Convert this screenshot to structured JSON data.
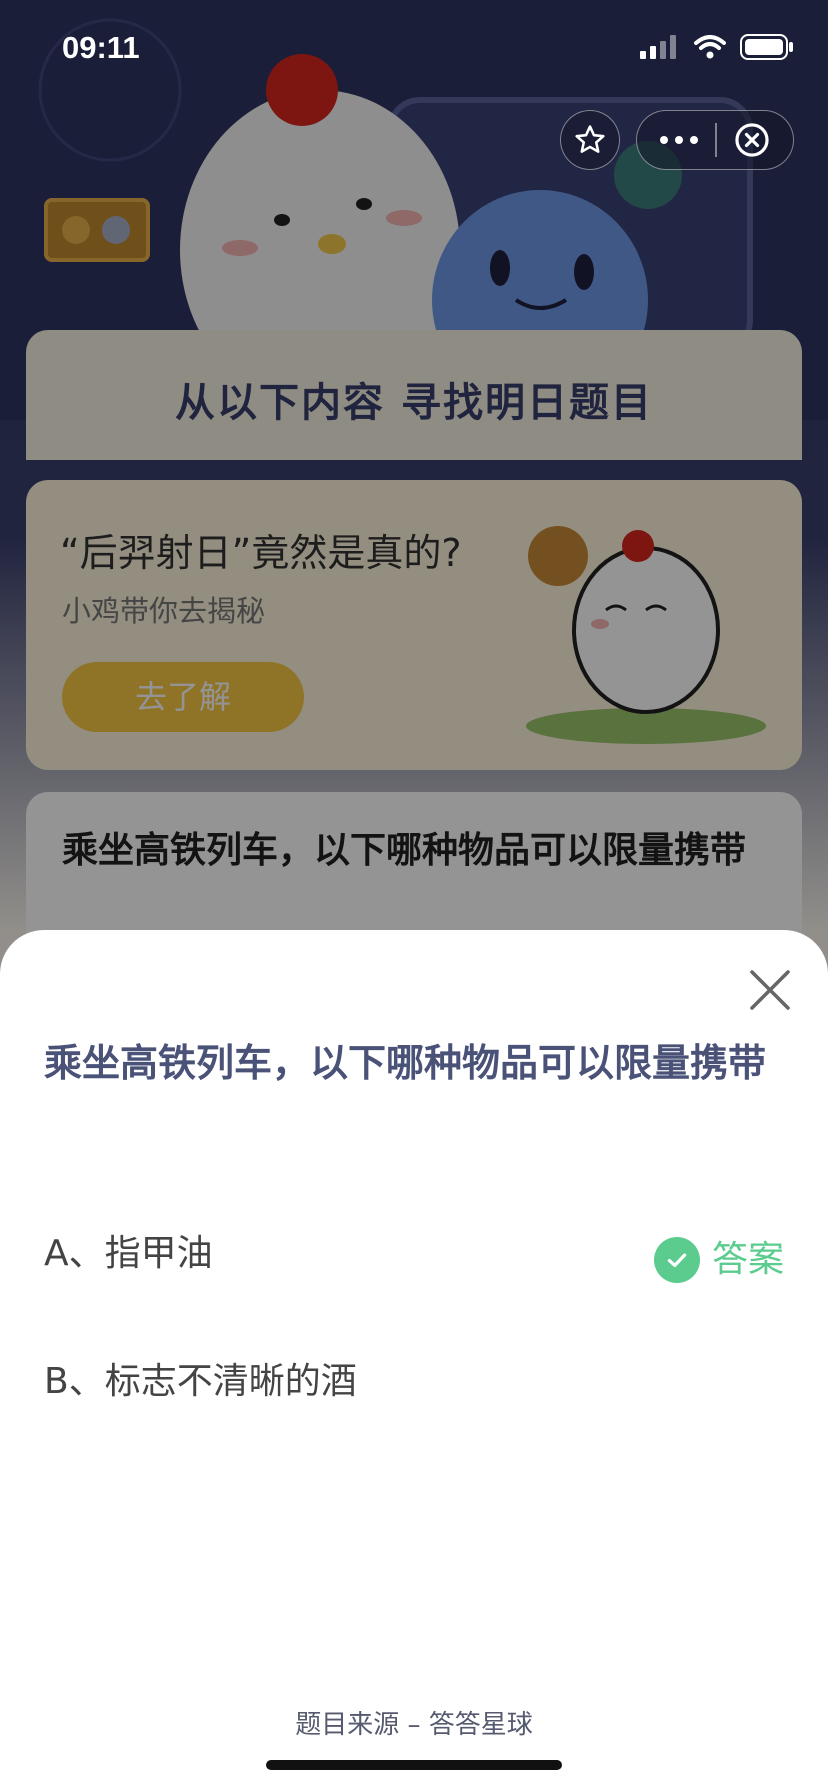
{
  "status_bar": {
    "time": "09:11"
  },
  "background_page": {
    "section_title": "从以下内容 寻找明日题目",
    "promo": {
      "headline": "“后羿射日”竟然是真的?",
      "subtitle": "小鸡带你去揭秘",
      "button_label": "去了解"
    },
    "question_preview": "乘坐高铁列车，以下哪种物品可以限量携带"
  },
  "sheet": {
    "question": "乘坐高铁列车，以下哪种物品可以限量携带",
    "options": [
      {
        "label": "A、指甲油",
        "is_answer": true
      },
      {
        "label": "B、标志不清晰的酒",
        "is_answer": false
      }
    ],
    "answer_label": "答案"
  },
  "footer": {
    "source": "题目来源 – 答答星球"
  },
  "colors": {
    "answer_green": "#5ccb8e",
    "question_text": "#4a5278",
    "promo_button": "#f6c744"
  },
  "icons": {
    "status": [
      "signal-icon",
      "wifi-icon",
      "battery-icon"
    ],
    "capsule": [
      "star-icon",
      "more-icon",
      "exit-icon"
    ],
    "sheet_close": "close-icon",
    "answer_mark": "check-icon"
  }
}
